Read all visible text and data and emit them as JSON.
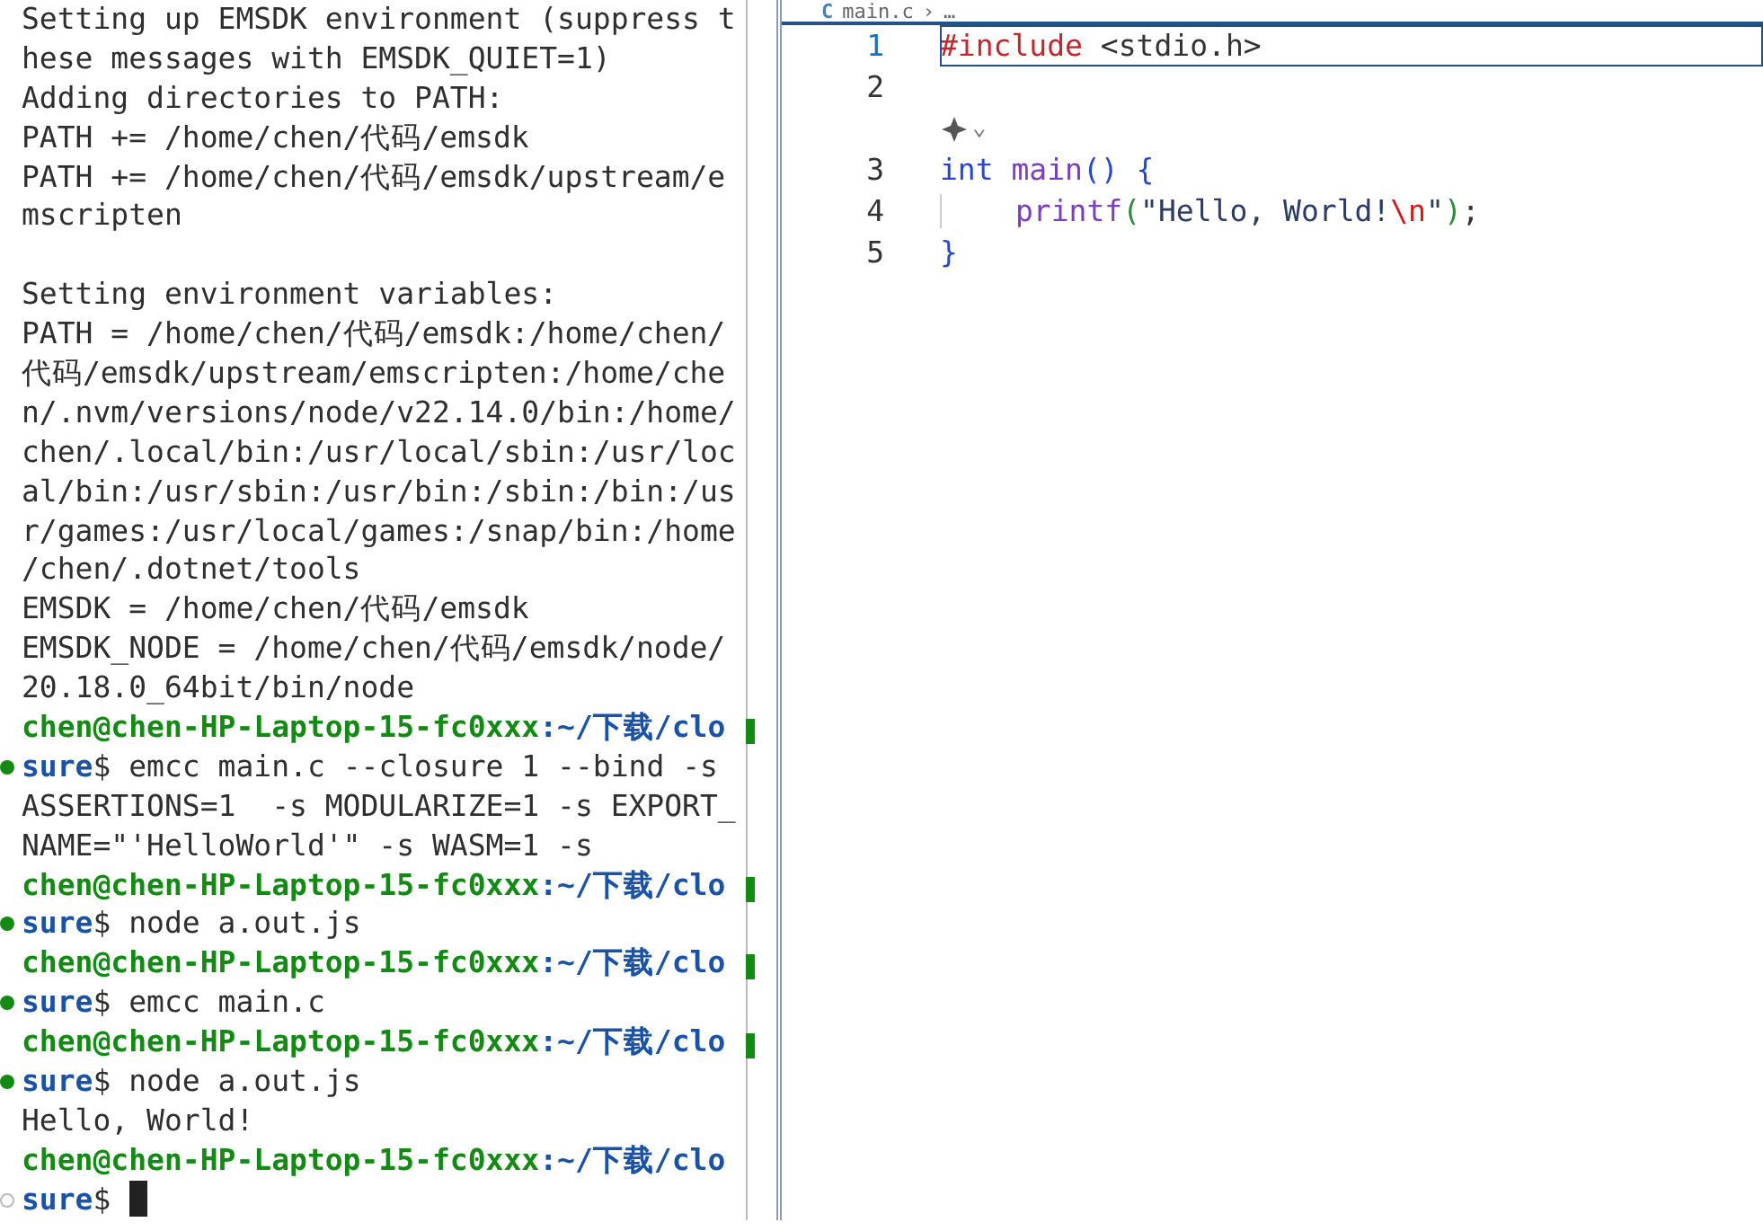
{
  "terminal": {
    "lines": [
      {
        "kind": "text",
        "text": "Setting up EMSDK environment (suppress t"
      },
      {
        "kind": "text",
        "text": "hese messages with EMSDK_QUIET=1)"
      },
      {
        "kind": "text",
        "text": "Adding directories to PATH:"
      },
      {
        "kind": "text",
        "text": "PATH += /home/chen/代码/emsdk"
      },
      {
        "kind": "text",
        "text": "PATH += /home/chen/代码/emsdk/upstream/e"
      },
      {
        "kind": "text",
        "text": "mscripten"
      },
      {
        "kind": "blank"
      },
      {
        "kind": "text",
        "text": "Setting environment variables:"
      },
      {
        "kind": "text",
        "text": "PATH = /home/chen/代码/emsdk:/home/chen/"
      },
      {
        "kind": "text",
        "text": "代码/emsdk/upstream/emscripten:/home/che"
      },
      {
        "kind": "text",
        "text": "n/.nvm/versions/node/v22.14.0/bin:/home/"
      },
      {
        "kind": "text",
        "text": "chen/.local/bin:/usr/local/sbin:/usr/loc"
      },
      {
        "kind": "text",
        "text": "al/bin:/usr/sbin:/usr/bin:/sbin:/bin:/us"
      },
      {
        "kind": "text",
        "text": "r/games:/usr/local/games:/snap/bin:/home"
      },
      {
        "kind": "text",
        "text": "/chen/.dotnet/tools"
      },
      {
        "kind": "text",
        "text": "EMSDK = /home/chen/代码/emsdk"
      },
      {
        "kind": "text",
        "text": "EMSDK_NODE = /home/chen/代码/emsdk/node/"
      },
      {
        "kind": "text",
        "text": "20.18.0_64bit/bin/node"
      },
      {
        "kind": "prompt",
        "user": "chen@chen-HP-Laptop-15-fc0xxx",
        "path": ":~/下载/clo",
        "marked": true
      },
      {
        "kind": "command",
        "path": "sure",
        "text": "$ emcc main.c --closure 1 --bind -s",
        "finished": true
      },
      {
        "kind": "text",
        "text": "ASSERTIONS=1  -s MODULARIZE=1 -s EXPORT_"
      },
      {
        "kind": "text",
        "text": "NAME=\"'HelloWorld'\" -s WASM=1 -s"
      },
      {
        "kind": "prompt",
        "user": "chen@chen-HP-Laptop-15-fc0xxx",
        "path": ":~/下载/clo",
        "marked": true
      },
      {
        "kind": "command",
        "path": "sure",
        "text": "$ node a.out.js",
        "finished": true
      },
      {
        "kind": "prompt",
        "user": "chen@chen-HP-Laptop-15-fc0xxx",
        "path": ":~/下载/clo",
        "marked": true
      },
      {
        "kind": "command",
        "path": "sure",
        "text": "$ emcc main.c",
        "finished": true
      },
      {
        "kind": "prompt",
        "user": "chen@chen-HP-Laptop-15-fc0xxx",
        "path": ":~/下载/clo",
        "marked": true
      },
      {
        "kind": "command",
        "path": "sure",
        "text": "$ node a.out.js",
        "finished": true
      },
      {
        "kind": "text",
        "text": "Hello, World!"
      },
      {
        "kind": "prompt",
        "user": "chen@chen-HP-Laptop-15-fc0xxx",
        "path": ":~/下载/clo",
        "marked": false
      },
      {
        "kind": "command",
        "path": "sure",
        "text": "$",
        "finished": false,
        "cursor": true
      }
    ]
  },
  "editor": {
    "breadcrumb": {
      "icon": "C",
      "file": "main.c",
      "separator": "›",
      "more": "…"
    },
    "lines": [
      {
        "kind": "code",
        "number": "1",
        "current": true,
        "tokens": [
          {
            "kind": "directive",
            "text": "#include"
          },
          {
            "kind": "plain",
            "text": " <stdio.h>"
          }
        ]
      },
      {
        "kind": "code",
        "number": "2",
        "current": false
      },
      {
        "kind": "lens",
        "chevron": "⌄"
      },
      {
        "kind": "code",
        "number": "3",
        "current": false,
        "tokens": [
          {
            "kind": "keyword",
            "text": "int "
          },
          {
            "kind": "function",
            "text": "main"
          },
          {
            "kind": "bracket",
            "text": "() {"
          }
        ]
      },
      {
        "kind": "code",
        "number": "4",
        "current": false,
        "indent": true,
        "tokens": [
          {
            "kind": "function",
            "text": "printf"
          },
          {
            "kind": "paren",
            "text": "("
          },
          {
            "kind": "string",
            "text": "\"Hello, World!"
          },
          {
            "kind": "escape",
            "text": "\\n"
          },
          {
            "kind": "string",
            "text": "\""
          },
          {
            "kind": "paren",
            "text": ")"
          },
          {
            "kind": "plain",
            "text": ";"
          }
        ]
      },
      {
        "kind": "code",
        "number": "5",
        "current": false,
        "tokens": [
          {
            "kind": "bracket",
            "text": "}"
          }
        ]
      }
    ]
  }
}
